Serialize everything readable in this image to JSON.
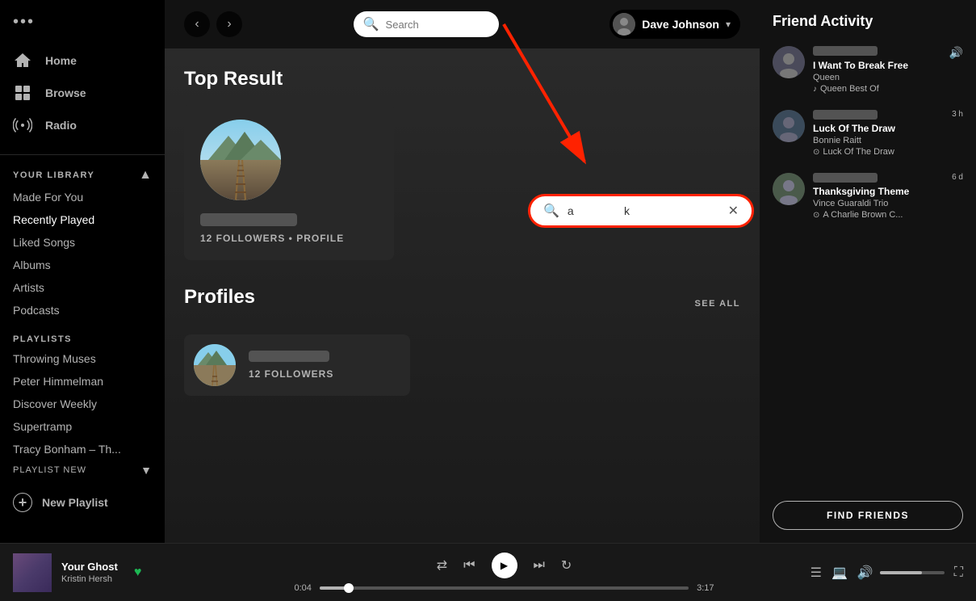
{
  "sidebar": {
    "dots_label": "•••",
    "nav": {
      "home_label": "Home",
      "browse_label": "Browse",
      "radio_label": "Radio"
    },
    "your_library_title": "YOUR LIBRARY",
    "library_items": [
      {
        "label": "Made For You"
      },
      {
        "label": "Recently Played"
      },
      {
        "label": "Liked Songs"
      },
      {
        "label": "Albums"
      },
      {
        "label": "Artists"
      },
      {
        "label": "Podcasts"
      }
    ],
    "playlists_title": "PLAYLISTS",
    "playlists": [
      {
        "label": "Throwing Muses"
      },
      {
        "label": "Peter Himmelman"
      },
      {
        "label": "Discover Weekly"
      },
      {
        "label": "Supertramp"
      },
      {
        "label": "Tracy Bonham – Th..."
      }
    ],
    "new_playlist_label": "New Playlist"
  },
  "header": {
    "search_placeholder": "Search",
    "search_value": "",
    "user_name": "Dave Johnson"
  },
  "main": {
    "top_result_title": "Top Result",
    "top_result_followers": "12 FOLLOWERS • PROFILE",
    "profiles_title": "Profiles",
    "see_all_label": "SEE ALL",
    "profile_followers": "12 FOLLOWERS"
  },
  "search_bar": {
    "value": "a                k",
    "placeholder": "Search"
  },
  "friend_activity": {
    "title": "Friend Activity",
    "friends": [
      {
        "track": "I Want To Break Free",
        "artist": "Queen",
        "album": "Queen Best Of",
        "time": "",
        "is_playing": true
      },
      {
        "track": "Luck Of The Draw",
        "artist": "Bonnie Raitt",
        "album": "Luck Of The Draw",
        "time": "3 h",
        "is_playing": false
      },
      {
        "track": "Thanksgiving Theme",
        "artist": "Vince Guaraldi Trio",
        "album": "A Charlie Brown C...",
        "time": "6 d",
        "is_playing": false
      }
    ],
    "find_friends_label": "FIND FRIENDS"
  },
  "player": {
    "track_name": "Your Ghost",
    "artist_name": "Kristin Hersh",
    "current_time": "0:04",
    "total_time": "3:17"
  }
}
